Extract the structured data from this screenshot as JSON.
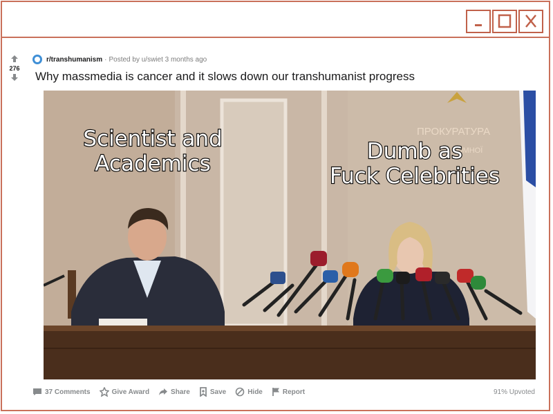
{
  "window": {
    "accent_color": "#c9705a",
    "buttons": [
      "minimize-icon",
      "maximize-icon",
      "close-icon"
    ]
  },
  "post": {
    "score": "276",
    "subreddit": "r/transhumanism",
    "posted_by": "Posted by u/swiet 3 months ago",
    "separator": "·",
    "title": "Why massmedia is cancer and it slows down our transhumanist progress"
  },
  "meme": {
    "caption_left_line1": "Scientist and",
    "caption_left_line2": "Academics",
    "caption_right_line1": "Dumb as",
    "caption_right_line2": "Fuck Celebrities",
    "wall_sign_line1": "ПРОКУРАТУРА",
    "wall_sign_line2": "ОМНОЇ"
  },
  "actions": {
    "comments": "37 Comments",
    "award": "Give Award",
    "share": "Share",
    "save": "Save",
    "hide": "Hide",
    "report": "Report",
    "upvoted": "91% Upvoted"
  }
}
